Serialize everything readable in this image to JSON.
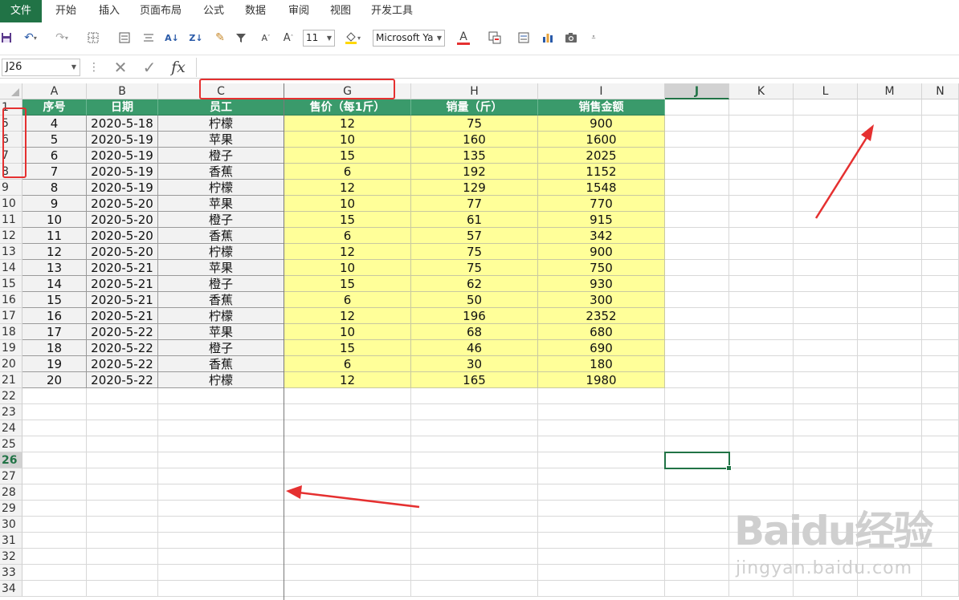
{
  "ribbon": {
    "tabs": [
      "文件",
      "开始",
      "插入",
      "页面布局",
      "公式",
      "数据",
      "审阅",
      "视图",
      "开发工具"
    ]
  },
  "toolbar": {
    "font_size": "11",
    "font_name": "Microsoft Ya",
    "font_color_glyph": "A",
    "icons": [
      "save-icon",
      "undo-icon",
      "redo-icon",
      "borders-icon",
      "align-icon",
      "center-icon",
      "sort-asc-icon",
      "sort-desc-icon",
      "format-painter-icon",
      "filter-icon",
      "decrease-font-icon",
      "increase-font-icon",
      "fill-color-icon",
      "font-color-icon",
      "conditional-format-icon",
      "form-icon",
      "chart-icon",
      "camera-icon",
      "customize-icon"
    ]
  },
  "formula_bar": {
    "name_box": "J26",
    "fx": "fx",
    "value": ""
  },
  "grid": {
    "columns": [
      "A",
      "B",
      "C",
      "G",
      "H",
      "I",
      "J",
      "K",
      "L",
      "M",
      "N"
    ],
    "selected_column": "J",
    "selected_row": "26",
    "header_row": [
      "序号",
      "日期",
      "员工",
      "售价（每1斤）",
      "销量（斤）",
      "销售金额"
    ],
    "row_numbers": [
      "1",
      "5",
      "6",
      "7",
      "8",
      "9",
      "10",
      "11",
      "12",
      "13",
      "14",
      "15",
      "16",
      "17",
      "18",
      "19",
      "20",
      "21",
      "22",
      "23",
      "24",
      "25",
      "26",
      "27",
      "28",
      "29",
      "30",
      "31",
      "32",
      "33",
      "34"
    ],
    "rows": [
      [
        "4",
        "2020-5-18",
        "柠檬",
        "12",
        "75",
        "900"
      ],
      [
        "5",
        "2020-5-19",
        "苹果",
        "10",
        "160",
        "1600"
      ],
      [
        "6",
        "2020-5-19",
        "橙子",
        "15",
        "135",
        "2025"
      ],
      [
        "7",
        "2020-5-19",
        "香蕉",
        "6",
        "192",
        "1152"
      ],
      [
        "8",
        "2020-5-19",
        "柠檬",
        "12",
        "129",
        "1548"
      ],
      [
        "9",
        "2020-5-20",
        "苹果",
        "10",
        "77",
        "770"
      ],
      [
        "10",
        "2020-5-20",
        "橙子",
        "15",
        "61",
        "915"
      ],
      [
        "11",
        "2020-5-20",
        "香蕉",
        "6",
        "57",
        "342"
      ],
      [
        "12",
        "2020-5-20",
        "柠檬",
        "12",
        "75",
        "900"
      ],
      [
        "13",
        "2020-5-21",
        "苹果",
        "10",
        "75",
        "750"
      ],
      [
        "14",
        "2020-5-21",
        "橙子",
        "15",
        "62",
        "930"
      ],
      [
        "15",
        "2020-5-21",
        "香蕉",
        "6",
        "50",
        "300"
      ],
      [
        "16",
        "2020-5-21",
        "柠檬",
        "12",
        "196",
        "2352"
      ],
      [
        "17",
        "2020-5-22",
        "苹果",
        "10",
        "68",
        "680"
      ],
      [
        "18",
        "2020-5-22",
        "橙子",
        "15",
        "46",
        "690"
      ],
      [
        "19",
        "2020-5-22",
        "香蕉",
        "6",
        "30",
        "180"
      ],
      [
        "20",
        "2020-5-22",
        "柠檬",
        "12",
        "165",
        "1980"
      ]
    ]
  },
  "watermark": {
    "logo": "Baidu经验",
    "url": "jingyan.baidu.com"
  },
  "colors": {
    "excel_green": "#217346",
    "header_green": "#3a9a6b",
    "highlight_yellow": "#ffff99",
    "annotation_red": "#e53030"
  }
}
